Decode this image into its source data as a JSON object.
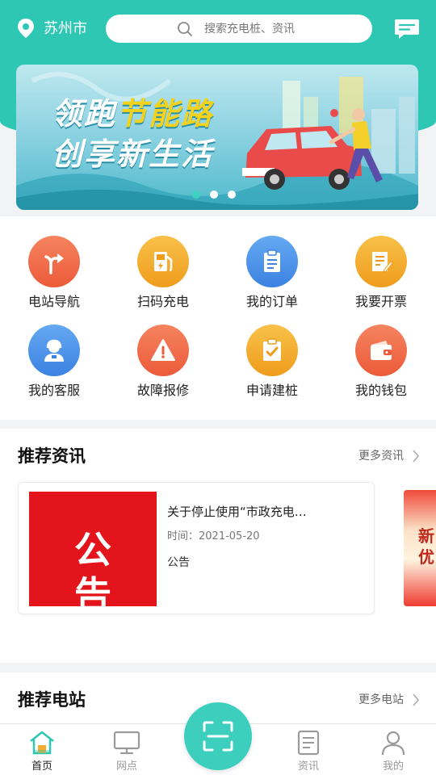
{
  "header": {
    "city": "苏州市",
    "search_placeholder": "搜索充电桩、资讯"
  },
  "banner": {
    "line1_a": "领跑",
    "line1_b": "节能路",
    "line2": "创享新生活",
    "slide_count": 3,
    "active_slide": 1
  },
  "shortcuts": [
    {
      "label": "电站导航",
      "icon": "navigation-icon",
      "color": "#f06a45"
    },
    {
      "label": "扫码充电",
      "icon": "fuel-pump-icon",
      "color": "#f3ad2e"
    },
    {
      "label": "我的订单",
      "icon": "clipboard-icon",
      "color": "#4b95ea"
    },
    {
      "label": "我要开票",
      "icon": "invoice-icon",
      "color": "#f3ad2e"
    },
    {
      "label": "我的客服",
      "icon": "customer-service-icon",
      "color": "#4b95ea"
    },
    {
      "label": "故障报修",
      "icon": "warning-icon",
      "color": "#f06a45"
    },
    {
      "label": "申请建桩",
      "icon": "checklist-icon",
      "color": "#f3ad2e"
    },
    {
      "label": "我的钱包",
      "icon": "wallet-icon",
      "color": "#f06a45"
    }
  ],
  "news": {
    "title": "推荐资讯",
    "more": "更多资讯",
    "items": [
      {
        "image_text": "公告",
        "title": "关于停止使用“市政充电…",
        "time": "时间：2021-05-20",
        "tag": "公告"
      }
    ],
    "next_card_text": "新\n优"
  },
  "stations": {
    "title": "推荐电站",
    "more": "更多电站"
  },
  "tabbar": {
    "home": "首页",
    "outlets": "网点",
    "news": "资讯",
    "mine": "我的"
  },
  "colors": {
    "brand": "#2ec7b4",
    "scan_button": "#3ccfbe"
  }
}
